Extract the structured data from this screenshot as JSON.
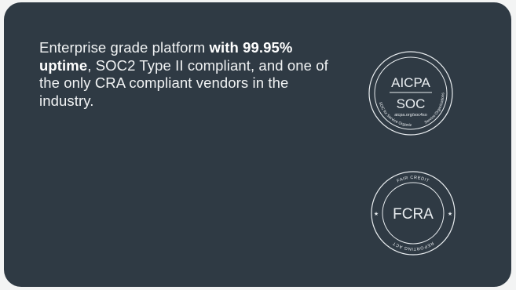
{
  "blurb": {
    "lead": "Enterprise grade platform ",
    "highlight": "with 99.95% uptime",
    "tail": ", SOC2 Type II compliant, and one of the only CRA compliant vendors in the industry."
  },
  "badges": {
    "aicpa": {
      "top": "AICPA",
      "bottom": "SOC",
      "url": "aicpa.org/soc4so",
      "arc_left": "SOC for Service Organizations",
      "arc_right": "Service Organizations"
    },
    "fcra": {
      "center": "FCRA",
      "arc_top": "FAIR CREDIT",
      "arc_bottom": "REPORTING ACT",
      "star_glyph": "★"
    }
  },
  "colors": {
    "page_background": "#f3f4f4",
    "card_background": "#2f3a44",
    "text": "#f1f3f4",
    "badge_stroke": "#e9edf0"
  }
}
